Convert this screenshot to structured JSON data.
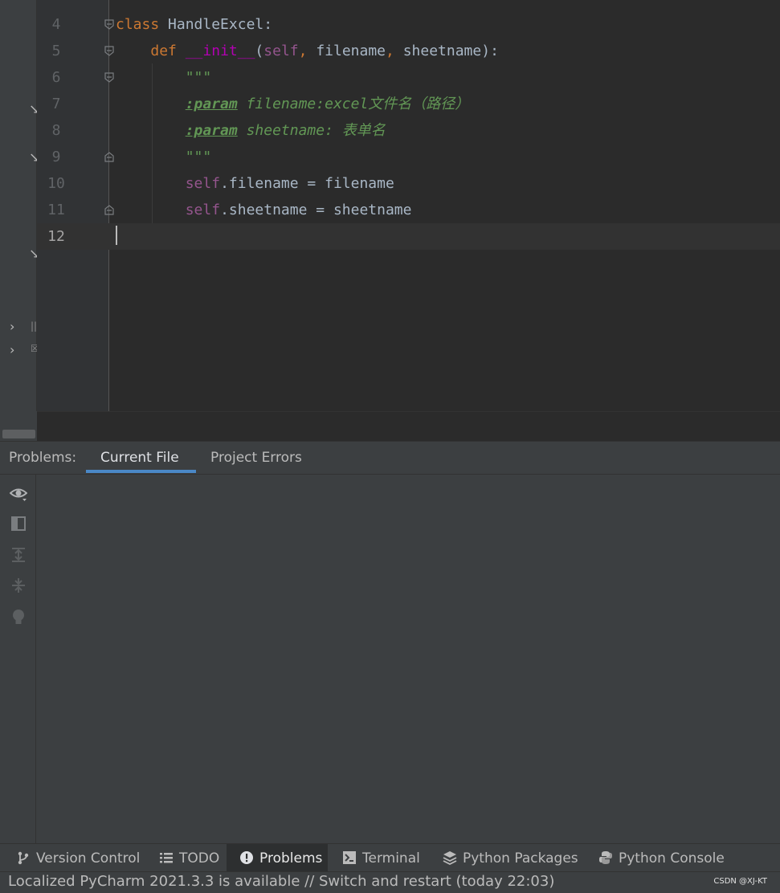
{
  "editor": {
    "lines": [
      {
        "no": "4",
        "tokens": [
          {
            "t": "kw",
            "v": "class "
          },
          {
            "t": "cls",
            "v": "HandleExcel:"
          }
        ]
      },
      {
        "no": "5",
        "tokens": [
          {
            "t": "txt",
            "v": "    "
          },
          {
            "t": "kw",
            "v": "def "
          },
          {
            "t": "fn",
            "v": "__init__"
          },
          {
            "t": "txt",
            "v": "("
          },
          {
            "t": "self",
            "v": "self"
          },
          {
            "t": "kw",
            "v": ", "
          },
          {
            "t": "txt",
            "v": "filename"
          },
          {
            "t": "kw",
            "v": ", "
          },
          {
            "t": "txt",
            "v": "sheetname):"
          }
        ]
      },
      {
        "no": "6",
        "tokens": [
          {
            "t": "txt",
            "v": "        "
          },
          {
            "t": "doc",
            "v": "\"\"\""
          }
        ]
      },
      {
        "no": "7",
        "tokens": [
          {
            "t": "txt",
            "v": "        "
          },
          {
            "t": "tag",
            "v": ":param"
          },
          {
            "t": "doc",
            "v": " filename:excel文件名（路径）"
          }
        ]
      },
      {
        "no": "8",
        "tokens": [
          {
            "t": "txt",
            "v": "        "
          },
          {
            "t": "tag",
            "v": ":param"
          },
          {
            "t": "doc",
            "v": " sheetname: 表单名"
          }
        ]
      },
      {
        "no": "9",
        "tokens": [
          {
            "t": "txt",
            "v": "        "
          },
          {
            "t": "doc",
            "v": "\"\"\""
          }
        ]
      },
      {
        "no": "10",
        "tokens": [
          {
            "t": "txt",
            "v": "        "
          },
          {
            "t": "self",
            "v": "self"
          },
          {
            "t": "txt",
            "v": ".filename = filename"
          }
        ]
      },
      {
        "no": "11",
        "tokens": [
          {
            "t": "txt",
            "v": "        "
          },
          {
            "t": "self",
            "v": "self"
          },
          {
            "t": "txt",
            "v": ".sheetname = sheetname"
          }
        ]
      },
      {
        "no": "12",
        "tokens": []
      }
    ],
    "current_line": "12"
  },
  "problems": {
    "label": "Problems:",
    "tabs": [
      {
        "label": "Current File"
      },
      {
        "label": "Project Errors"
      }
    ]
  },
  "toolwindows": [
    {
      "label": "Version Control",
      "icon": "vcs-branch-icon"
    },
    {
      "label": "TODO",
      "icon": "list-icon"
    },
    {
      "label": "Problems",
      "icon": "problems-icon"
    },
    {
      "label": "Terminal",
      "icon": "terminal-icon"
    },
    {
      "label": "Python Packages",
      "icon": "layers-icon"
    },
    {
      "label": "Python Console",
      "icon": "python-icon"
    }
  ],
  "status": {
    "message": "Localized PyCharm 2021.3.3 is available // Switch and restart (today 22:03)",
    "watermark": "CSDN @XJ-KT"
  }
}
